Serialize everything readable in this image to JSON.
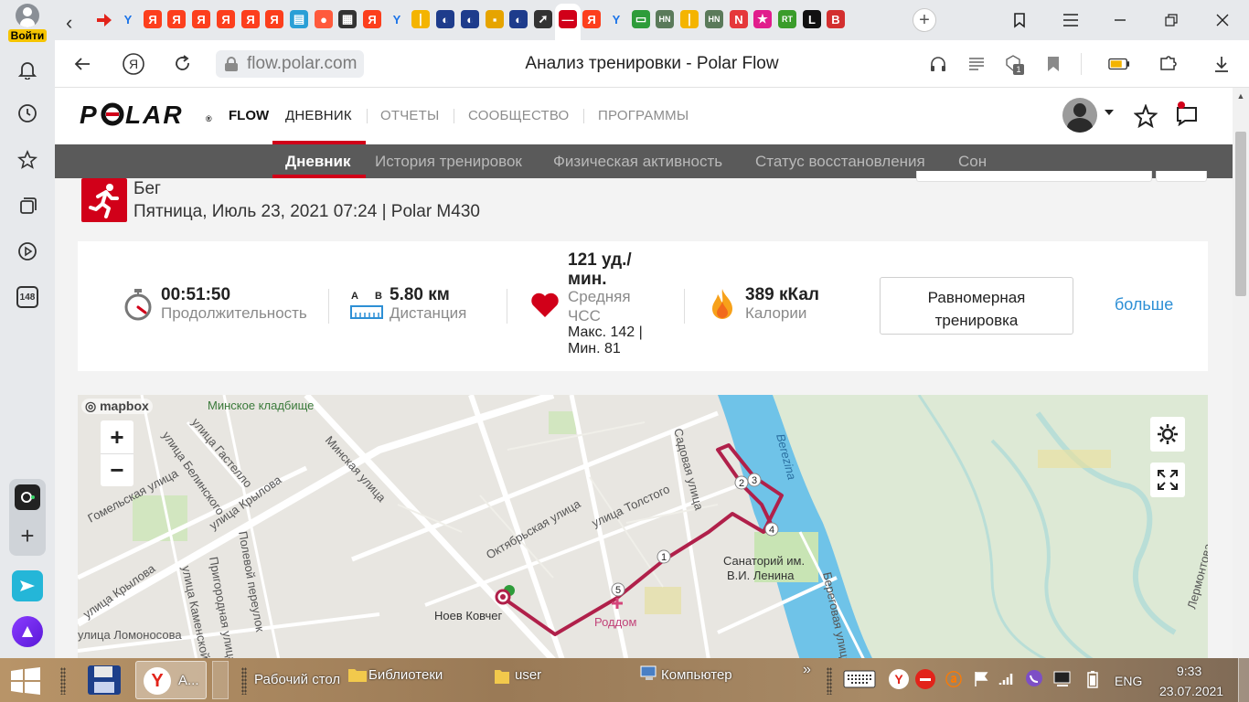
{
  "left_sidebar": {
    "login_label": "Войти",
    "counter_badge": "148",
    "icons": [
      "user-icon",
      "bell-icon",
      "history-icon",
      "star-icon",
      "collections-icon",
      "play-icon",
      "counter-icon",
      "alice-widget-icon",
      "plus-icon",
      "messenger-icon",
      "alice-icon"
    ]
  },
  "tabstrip": {
    "tabs": [
      {
        "glyph": "Y",
        "color": "#1a73e8",
        "text_color": "#1a73e8",
        "bg": "transparent"
      },
      {
        "glyph": "Я",
        "color": "#fc3f1d"
      },
      {
        "glyph": "Я",
        "color": "#fc3f1d"
      },
      {
        "glyph": "Я",
        "color": "#fc3f1d"
      },
      {
        "glyph": "Я",
        "color": "#fc3f1d"
      },
      {
        "glyph": "Я",
        "color": "#fc3f1d"
      },
      {
        "glyph": "Я",
        "color": "#fc3f1d"
      },
      {
        "glyph": "▤",
        "color": "#2a9fd6"
      },
      {
        "glyph": "●",
        "color": "#ff5a3c"
      },
      {
        "glyph": "▦",
        "color": "#333333"
      },
      {
        "glyph": "Я",
        "color": "#fc3f1d"
      },
      {
        "glyph": "Y",
        "color": "#1a73e8",
        "text_color": "#1a73e8",
        "bg": "transparent"
      },
      {
        "glyph": "❘",
        "color": "#f4b400"
      },
      {
        "glyph": "◐",
        "color": "#1e3c8c"
      },
      {
        "glyph": "◐",
        "color": "#1e3c8c"
      },
      {
        "glyph": "▪",
        "color": "#e6a400"
      },
      {
        "glyph": "◐",
        "color": "#1e3c8c"
      },
      {
        "glyph": "➚",
        "color": "#333333"
      },
      {
        "glyph": "—",
        "color": "#d10019"
      },
      {
        "glyph": "Я",
        "color": "#fc3f1d"
      },
      {
        "glyph": "Y",
        "color": "#1a73e8",
        "text_color": "#1a73e8",
        "bg": "transparent"
      },
      {
        "glyph": "▭",
        "color": "#2e9c3a"
      },
      {
        "glyph": "HN",
        "color": "#5a7a5a"
      },
      {
        "glyph": "❘",
        "color": "#f4b400"
      },
      {
        "glyph": "HN",
        "color": "#5a7a5a"
      },
      {
        "glyph": "N",
        "color": "#e5383b"
      },
      {
        "glyph": "★",
        "color": "#e11d8c"
      },
      {
        "glyph": "RT",
        "color": "#3a9c2a"
      },
      {
        "glyph": "L",
        "color": "#111111"
      },
      {
        "glyph": "B",
        "color": "#d32f2f"
      }
    ],
    "new_tab_label": "+"
  },
  "addressbar": {
    "url": "flow.polar.com",
    "page_title": "Анализ тренировки - Polar Flow",
    "badge_count": "1"
  },
  "polar": {
    "logo_text": "POLAR",
    "logo_reg": "®",
    "flow": "FLOW",
    "nav": [
      "ДНЕВНИК",
      "ОТЧЕТЫ",
      "СООБЩЕСТВО",
      "ПРОГРАММЫ"
    ],
    "subnav": [
      "Дневник",
      "История тренировок",
      "Физическая активность",
      "Статус восстановления",
      "Сон"
    ]
  },
  "activity": {
    "sport": "Бег",
    "details": "Пятница, Июль 23, 2021 07:24 | Polar M430"
  },
  "summary": {
    "duration_value": "00:51:50",
    "duration_label": "Продолжительность",
    "distance_a": "A",
    "distance_b": "B",
    "distance_value": "5.80 км",
    "distance_label": "Дистанция",
    "hr_value_1": "121 уд./",
    "hr_value_2": "мин.",
    "hr_label_1": "Средняя",
    "hr_label_2": "ЧСС",
    "hr_extra_1": "Макс. 142  |",
    "hr_extra_2": "Мин. 81",
    "calories_value": "389 кКал",
    "calories_label": "Калории",
    "training_btn_1": "Равномерная",
    "training_btn_2": "тренировка",
    "more_link": "больше"
  },
  "map": {
    "attribution": "mapbox",
    "zoom_in": "+",
    "zoom_out": "−",
    "labels": {
      "cemetery": "Минское кладбище",
      "gastello": "улица Гастелло",
      "belinsky": "улица Белинского",
      "gomel": "Гомельская улица",
      "krylova1": "улица Крылова",
      "krylova2": "улица Крылова",
      "minsk": "Минская улица",
      "oktyabr": "Октябрьская улица",
      "tolstogo": "улица Толстого",
      "sadovaya": "Садовая улица",
      "berezina": "Berezina",
      "sanatorium_1": "Санаторий им.",
      "sanatorium_2": "В.И. Ленина",
      "roddom": "Роддом",
      "noev": "Ноев Ковчег",
      "polevoy": "Полевой переулок",
      "prigorod": "Пригородная улица",
      "kamensk": "улица Каменской",
      "lomonosova": "улица Ломоносова",
      "beregovaya": "Береговая улица",
      "lermontova": "Лермонтова"
    },
    "markers": [
      "1",
      "2",
      "3",
      "4",
      "5"
    ]
  },
  "taskbar": {
    "app_label": "А...",
    "desktop": "Рабочий стол",
    "libraries": "Библиотеки",
    "user": "user",
    "computer": "Компьютер",
    "lang": "ENG",
    "time": "9:33",
    "date": "23.07.2021",
    "chevron": "»"
  }
}
